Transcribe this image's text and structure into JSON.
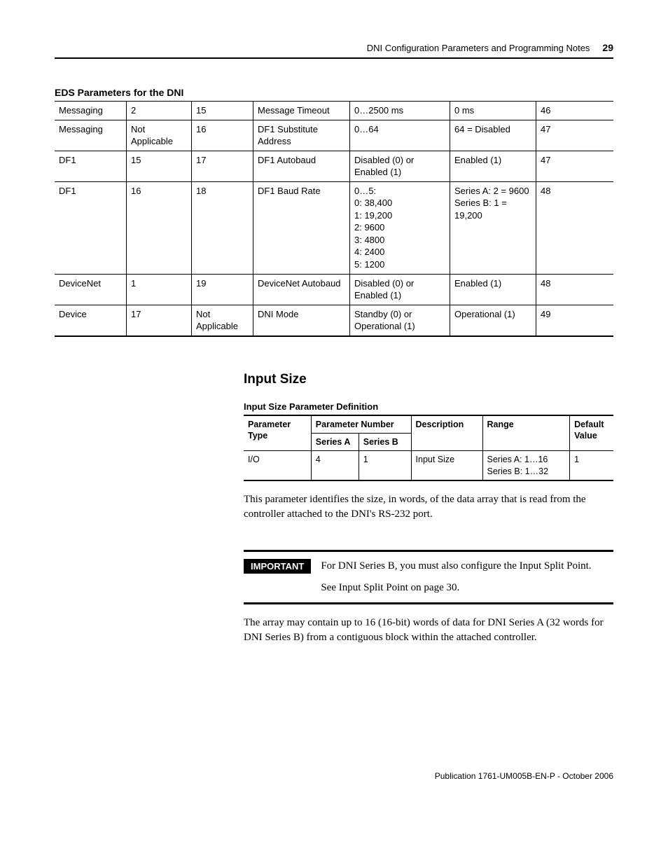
{
  "header": {
    "section": "DNI Configuration Parameters and Programming Notes",
    "page": "29"
  },
  "eds_table": {
    "title": "EDS Parameters for the DNI",
    "rows": [
      {
        "c0": "Messaging",
        "c1": "2",
        "c2": "15",
        "c3": "Message Timeout",
        "c4": "0…2500 ms",
        "c5": "0 ms",
        "c6": "46"
      },
      {
        "c0": "Messaging",
        "c1": "Not Applicable",
        "c2": "16",
        "c3": "DF1 Substitute Address",
        "c4": "0…64",
        "c5": "64 = Disabled",
        "c6": "47"
      },
      {
        "c0": "DF1",
        "c1": "15",
        "c2": "17",
        "c3": "DF1 Autobaud",
        "c4": "Disabled (0) or Enabled (1)",
        "c5": "Enabled (1)",
        "c6": "47"
      },
      {
        "c0": "DF1",
        "c1": "16",
        "c2": "18",
        "c3": "DF1 Baud Rate",
        "c4": "0…5:\n0: 38,400\n1: 19,200\n2: 9600\n3: 4800\n4: 2400\n5: 1200",
        "c5": "Series A: 2 = 9600\nSeries B: 1 = 19,200",
        "c6": "48"
      },
      {
        "c0": "DeviceNet",
        "c1": "1",
        "c2": "19",
        "c3": "DeviceNet Autobaud",
        "c4": "Disabled (0) or Enabled (1)",
        "c5": "Enabled (1)",
        "c6": "48"
      },
      {
        "c0": "Device",
        "c1": "17",
        "c2": "Not Applicable",
        "c3": "DNI Mode",
        "c4": "Standby (0) or Operational (1)",
        "c5": "Operational (1)",
        "c6": "49"
      }
    ]
  },
  "input_size": {
    "heading": "Input Size",
    "subhead": "Input Size Parameter Definition",
    "columns": {
      "param_type": "Parameter Type",
      "param_number": "Parameter Number",
      "series_a": "Series A",
      "series_b": "Series B",
      "description": "Description",
      "range": "Range",
      "default": "Default Value"
    },
    "row": {
      "type": "I/O",
      "a": "4",
      "b": "1",
      "desc": "Input Size",
      "range": "Series A: 1…16\nSeries B: 1…32",
      "def": "1"
    },
    "para1": "This parameter identifies the size, in words, of the data array that is read from the controller attached to the DNI's RS-232 port.",
    "important_label": "IMPORTANT",
    "important_p1": "For DNI Series B, you must also configure the Input Split Point.",
    "important_p2": "See Input Split Point on page 30.",
    "para2": "The array may contain up to 16 (16-bit) words of data for DNI Series A (32 words for DNI Series B) from a contiguous block within the attached controller."
  },
  "footer": "Publication 1761-UM005B-EN-P - October 2006"
}
